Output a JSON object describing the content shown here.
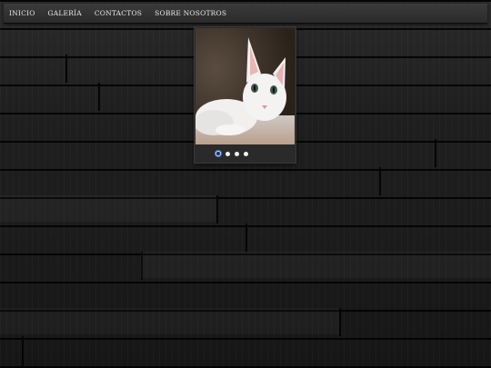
{
  "nav": {
    "items": [
      {
        "label": "INICIO"
      },
      {
        "label": "GALERÍA"
      },
      {
        "label": "CONTACTOS"
      },
      {
        "label": "SOBRE NOSOTROS"
      }
    ]
  },
  "slider": {
    "image": "white-kitten-photo",
    "slide_count": 4,
    "active_index": 0
  },
  "colors": {
    "background": "#1b1b1b",
    "nav_bar": "#333333",
    "nav_text": "#e8e8e8",
    "active_dot": "#4a78d8"
  }
}
